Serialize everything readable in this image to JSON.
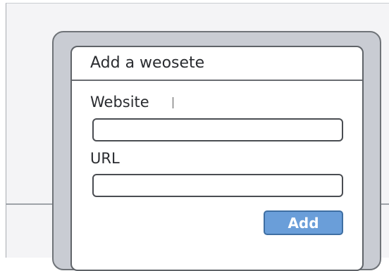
{
  "dialog": {
    "title": "Add a weosete",
    "website_label": "Website",
    "website_value": "",
    "url_label": "URL",
    "url_value": "",
    "add_label": "Add"
  },
  "colors": {
    "accent_button": "#6a9ed9",
    "button_border": "#3f6fa3",
    "frame": "#c9ccd3",
    "backdrop": "#f4f4f6"
  }
}
